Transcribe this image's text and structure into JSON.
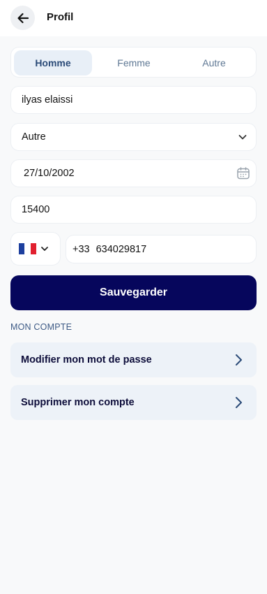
{
  "header": {
    "title": "Profil"
  },
  "gender": {
    "options": [
      "Homme",
      "Femme",
      "Autre"
    ],
    "selected": "Homme"
  },
  "form": {
    "name": "ilyas elaissi",
    "select_value": "Autre",
    "birthdate": "27/10/2002",
    "postal_code": "15400",
    "phone_code": "+33",
    "phone_number": "634029817"
  },
  "country_flag": {
    "country": "France",
    "colors": [
      "#1d3f9e",
      "#ffffff",
      "#e1202f"
    ]
  },
  "save_label": "Sauvegarder",
  "account": {
    "title": "MON COMPTE",
    "items": [
      {
        "label": "Modifier mon mot de passe"
      },
      {
        "label": "Supprimer mon compte"
      }
    ]
  },
  "icons": {
    "back": "arrow-left-icon",
    "dropdown": "chevron-down-icon",
    "calendar": "calendar-icon",
    "row": "chevron-right-icon"
  },
  "colors": {
    "primary": "#06065c",
    "segment_active_bg": "#e8eff7",
    "account_row_bg": "#edf2f8",
    "section_title": "#3d5a85"
  }
}
